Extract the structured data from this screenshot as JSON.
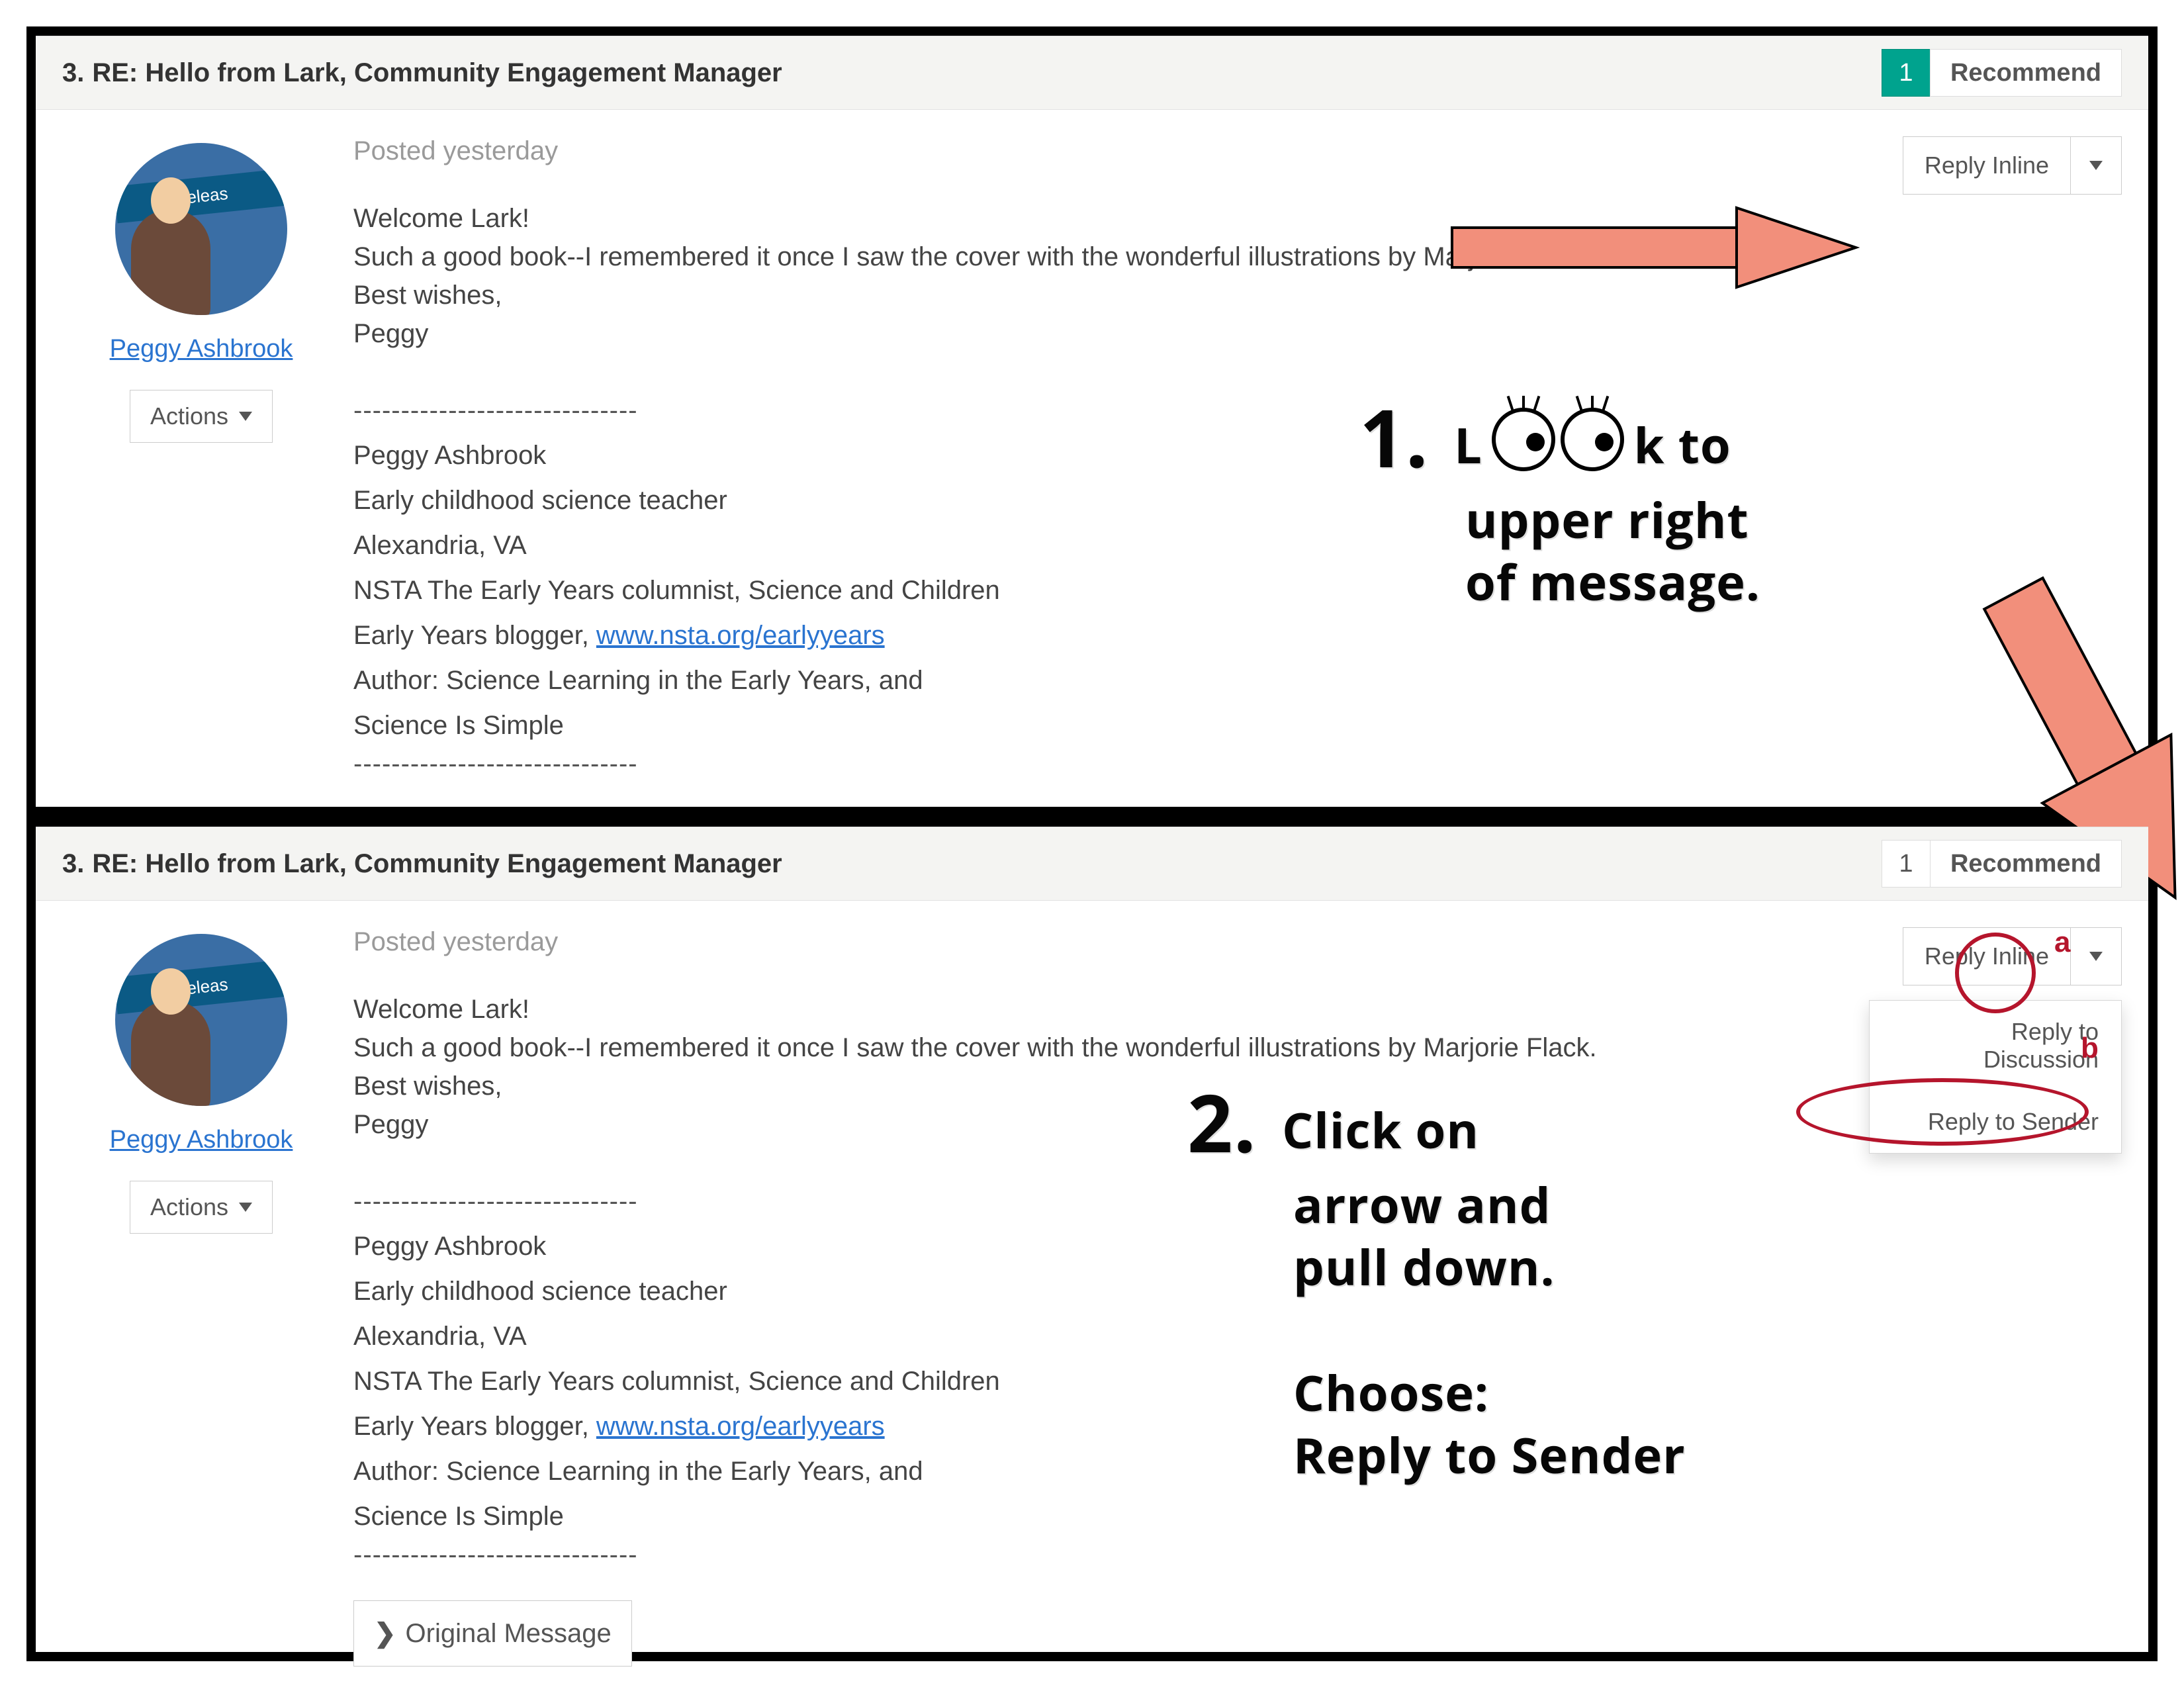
{
  "panel1": {
    "header": {
      "num": "3.",
      "title": "RE: Hello from Lark, Community Engagement Manager",
      "count": "1",
      "recommend": "Recommend"
    },
    "user": {
      "name": "Peggy Ashbrook",
      "actions": "Actions"
    },
    "reply": {
      "label": "Reply Inline"
    },
    "msg": {
      "posted": "Posted yesterday",
      "greet": "Welcome Lark!",
      "line1": "Such a good book--I remembered it once I saw the cover with the wonderful illustrations by Marjorie Flack.",
      "line2": "Best wishes,",
      "line3": "Peggy",
      "dashes": "------------------------------",
      "sig1": "Peggy Ashbrook",
      "sig2": "Early childhood science teacher",
      "sig3": "Alexandria, VA",
      "sig4": "NSTA The Early Years columnist, Science and Children",
      "sig5pre": "Early Years blogger, ",
      "sig5link": "www.nsta.org/earlyyears",
      "sig6": "Author: Science Learning in the Early Years, and",
      "sig7": "Science Is Simple"
    }
  },
  "panel2": {
    "header": {
      "num": "3.",
      "title": "RE: Hello from Lark, Community Engagement Manager",
      "count": "1",
      "recommend": "Recommend"
    },
    "user": {
      "name": "Peggy Ashbrook",
      "actions": "Actions"
    },
    "reply": {
      "label": "Reply Inline"
    },
    "dropdown": {
      "a": "Reply to Discussion",
      "b": "Reply to Sender"
    },
    "orig": "Original Message",
    "msg": {
      "posted": "Posted yesterday",
      "greet": "Welcome Lark!",
      "line1": "Such a good book--I remembered it once I saw the cover with the wonderful illustrations by Marjorie Flack.",
      "line2": "Best wishes,",
      "line3": "Peggy",
      "dashes": "------------------------------",
      "sig1": "Peggy Ashbrook",
      "sig2": "Early childhood science teacher",
      "sig3": "Alexandria, VA",
      "sig4": "NSTA The Early Years columnist, Science and Children",
      "sig5pre": "Early Years blogger, ",
      "sig5link": "www.nsta.org/earlyyears",
      "sig6": "Author: Science Learning in the Early Years, and",
      "sig7": "Science Is Simple"
    }
  },
  "instructions": {
    "step1": {
      "num": "1.",
      "l_pre": "L",
      "l_post": "k to",
      "line2": "upper right",
      "line3": "of message."
    },
    "step2": {
      "num": "2.",
      "line1": "Click on",
      "line2": "arrow and",
      "line3": "pull down.",
      "line4": "Choose:",
      "line5": "Reply to Sender"
    },
    "a": "a",
    "b": "b"
  }
}
